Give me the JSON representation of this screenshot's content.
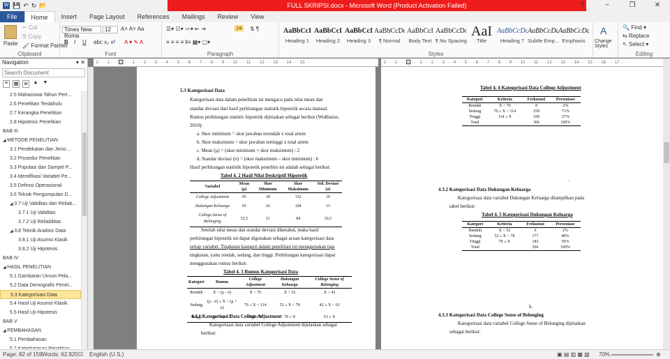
{
  "window": {
    "title": "FULL SKRIPSI.docx - Microsoft Word (Product Activation Failed)",
    "minimize": "−",
    "restore": "❐",
    "close": "✕"
  },
  "tabs": [
    "File",
    "Home",
    "Insert",
    "Page Layout",
    "References",
    "Mailings",
    "Review",
    "View"
  ],
  "ribbon": {
    "clipboard": {
      "paste": "Paste",
      "cut": "Cut",
      "copy": "Copy",
      "format_painter": "Format Painter",
      "label": "Clipboard"
    },
    "font": {
      "name": "Times New Roma",
      "size": "12",
      "label": "Font"
    },
    "paragraph": {
      "label": "Paragraph"
    },
    "styles": {
      "label": "Styles",
      "items": [
        {
          "preview": "AaBbCcI",
          "name": "Heading 1"
        },
        {
          "preview": "AaBbCcI",
          "name": "Heading 2"
        },
        {
          "preview": "AaBbCcI",
          "name": "Heading 3"
        },
        {
          "preview": "AaBbCcDd",
          "name": "¶ Normal"
        },
        {
          "preview": "AaBbCcI",
          "name": "Body Text"
        },
        {
          "preview": "AaBbCcDd",
          "name": "¶ No Spacing"
        },
        {
          "preview": "AaI",
          "name": "Title"
        },
        {
          "preview": "AaBbCcDc",
          "name": "Heading 7"
        },
        {
          "preview": "AaBbCcDd",
          "name": "Subtle Emp..."
        },
        {
          "preview": "AaBbCcDd",
          "name": "Emphasis"
        }
      ],
      "change_styles": "Change Styles"
    },
    "editing": {
      "find": "Find",
      "replace": "Replace",
      "select": "Select",
      "label": "Editing"
    }
  },
  "nav": {
    "title": "Navigation",
    "search_placeholder": "Search Document",
    "items": [
      {
        "label": "2.5 Mahasiswa Tahun Pert...",
        "level": 2
      },
      {
        "label": "2.6 Penelitian Terdahulu",
        "level": 2
      },
      {
        "label": "2.7 Kerangka Penelitian",
        "level": 2
      },
      {
        "label": "2.8 Hipotesis Penelitian",
        "level": 2
      },
      {
        "label": "BAB III",
        "level": 1
      },
      {
        "label": "METODE PENELITIAN",
        "level": 1,
        "exp": true
      },
      {
        "label": "3.1 Pendekatan dan Jenis ...",
        "level": 2
      },
      {
        "label": "3.2 Prosedur Penelitian",
        "level": 2
      },
      {
        "label": "3.3 Populasi dan Sampel P...",
        "level": 2
      },
      {
        "label": "3.4 Identifikasi Variabel Pe...",
        "level": 2
      },
      {
        "label": "3.5 Definisi Operasional",
        "level": 2
      },
      {
        "label": "3.6 Teknik Pengumpulan D...",
        "level": 2
      },
      {
        "label": "3.7 Uji Validitas dan Reliab...",
        "level": 2,
        "exp": true
      },
      {
        "label": "3.7.1 Uji Validitas",
        "level": 3
      },
      {
        "label": "3.7.2 Uji Reliabilitas",
        "level": 3
      },
      {
        "label": "3.8 Teknik Analisis Data",
        "level": 2,
        "exp": true
      },
      {
        "label": "3.8.1 Uji Asumsi Klasik",
        "level": 3
      },
      {
        "label": "3.8.2 Uji Hipotesis",
        "level": 3
      },
      {
        "label": "BAB IV",
        "level": 1
      },
      {
        "label": "HASIL PENELITIAN",
        "level": 1,
        "exp": true
      },
      {
        "label": "5.1 Gambaran Umum Pela...",
        "level": 2
      },
      {
        "label": "5.2 Data Demografis Penel...",
        "level": 2
      },
      {
        "label": "5.3 Kategorisasi Data",
        "level": 2,
        "selected": true
      },
      {
        "label": "5.4 Hasil Uji Asumsi Klasik",
        "level": 2
      },
      {
        "label": "5.5 Hasil Uji Hipotesis",
        "level": 2
      },
      {
        "label": "BAB V",
        "level": 1
      },
      {
        "label": "PEMBAHASAN",
        "level": 1,
        "exp": true
      },
      {
        "label": "5.1 Pembahasan",
        "level": 2
      },
      {
        "label": "5.2 Keterbatasan Penelitian",
        "level": 2
      }
    ]
  },
  "ruler": {
    "left": "· 2 · · · 1 · · · 🔲 · · · 1 · · · 2 · · · 3 · · · 4 · · · 5 · · · 6 · · · 7 · · · 8 · · · 9 · · · 10 · · · 11 · · · 12 · · · 13 · · · 14 · · · 15 · · ·",
    "right": "· 2 · · · 1 · · · 🔲 · · · 1 · · · 2 · · · 3 · · · 4 · · · 5 · · · 6 · · · 7 · · · 8 · · · 9 · · · 10 · · · 11 · · · 12 · · · 13 · · · 14 · · · 15 · · · 16 · · · 17 · · ·"
  },
  "left_page": {
    "heading": "5.3  Kategorisasi Data",
    "para1": [
      "Kategorisasi data dalam penelitian ini mengacu pada nilai mean dan",
      "standar deviasi dari hasil perhitungan statistik hipotetik secara manual.",
      "Rumus perhitungan statistic hipotetik dijelaskan sebagai berikut (Widhiarso,",
      "2010):"
    ],
    "list": [
      "a.    Skor minimum = skor jawaban terendah x total aitem",
      "b.    Skor maksimum = skor jawaban tertinggi x total aitem",
      "c.    Mean (μ) = (skor minimum + skor maksimum) : 2",
      "d.    Standar deviasi (σ) = (skor maksimum – skor minimum) : 6"
    ],
    "after_list": "Hasil perhitungan statistik hipotetik penelitin ini adalah sebagai berikut:",
    "t2_title": "Tabel 4. 2 Hasil Nilai Deskriptif Hipotetik",
    "t2_head": [
      "Variabel",
      "Mean (μ)",
      "Skor Minimum",
      "Skor Maksimum",
      "Std. Deviasi (σ)"
    ],
    "t2_rows": [
      [
        "College Adjustment",
        "95",
        "38",
        "152",
        "19"
      ],
      [
        "Dukungan Keluarga",
        "65",
        "26",
        "104",
        "13"
      ],
      [
        "College Sense of Belonging",
        "52,5",
        "21",
        "84",
        "10,5"
      ]
    ],
    "para2": [
      "Setelah nilai mean dan standar deviasi diketahui, maka hasil",
      "perhitungan hipotetik ini dapat digunakan sebagai acuan kategorisasi data",
      "setiap variabel. Tingkatan kategori dalam penelitian ini menggunakan tiga",
      "tingkatan, yaitu rendah, sedang, dan tinggi. Perhitungan kategorisasi dapat",
      "menggunakan rumus berikut:"
    ],
    "t3_title": "Tabel 4. 3 Rumus Kategorisasi Data",
    "t3_head": [
      "Kategori",
      "Rumus",
      "College Adjustment",
      "Dukungan Keluarga",
      "College Sense of Belonging"
    ],
    "t3_rows": [
      [
        "Rendah",
        "X < (μ - σ)",
        "X < 76",
        "X < 52",
        "X < 42"
      ],
      [
        "Sedang",
        "(μ - σ) ≤ X < (μ + σ)",
        "76 ≤ X < 114",
        "52 ≤ X < 78",
        "42 ≤ X < 63"
      ],
      [
        "Tinggi",
        "(μ + σ) ≤ X",
        "114 ≤ X",
        "78 ≤ X",
        "63 ≤ X"
      ]
    ],
    "sub1": "4.3.1 Kategorisasi Data College Adjustment",
    "para3": [
      "Kategorisasi data variabel College Adjustment dijelaskan sebagai",
      "berikut:"
    ]
  },
  "right_page": {
    "t4_title": "Tabel 4. 4 Kategorisasi Data College Adjustment",
    "t_head": [
      "Kategori",
      "Kriteria",
      "Frekuensi",
      "Persentase"
    ],
    "t4_rows": [
      [
        "Rendah",
        "X < 76",
        "8",
        "2%"
      ],
      [
        "Sedang",
        "76 ≤ X < 114",
        "258",
        "71%"
      ],
      [
        "Tinggi",
        "114 ≤ X",
        "100",
        "27%"
      ],
      [
        "Total",
        "",
        "366",
        "100%"
      ]
    ],
    "sub2": "4.3.2 Kategorisasi Data Dukungan Keluarga",
    "para4": [
      "Kategorisasi data variabel Dukungan Keluarga ditampilkan pada",
      "tabel berikut:"
    ],
    "t5_title": "Tabel 4. 5 Kategorisasi Dukungan Keluarga",
    "t5_rows": [
      [
        "Rendah",
        "X < 52",
        "6",
        "2%"
      ],
      [
        "Sedang",
        "52 ≤ X < 78",
        "177",
        "48%"
      ],
      [
        "Tinggi",
        "78 ≤ X",
        "183",
        "50%"
      ],
      [
        "Total",
        "",
        "366",
        "100%"
      ]
    ],
    "h_mark": "h.",
    "sub3": "4.3.3 Kategorisasi Data College Sense of Belonging",
    "para5": [
      "Kategorisasi data variabel College Sense of Belonging dijelaskan",
      "sebagai berikut:"
    ]
  },
  "status": {
    "page": "Page: 82 of 159",
    "words": "Words: 62.920",
    "lang": "English (U.S.)",
    "zoom": "70%"
  }
}
